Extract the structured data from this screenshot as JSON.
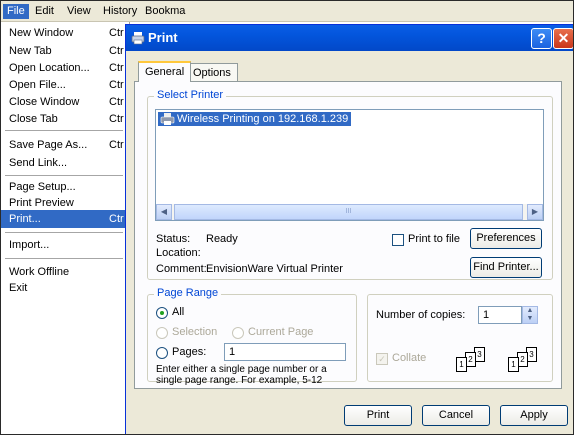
{
  "menubar": {
    "items": [
      "File",
      "Edit",
      "View",
      "History",
      "Bookma"
    ]
  },
  "file_menu": {
    "items": [
      {
        "label": "New Window",
        "shortcut": "Ctr"
      },
      {
        "label": "New Tab",
        "shortcut": "Ctr"
      },
      {
        "label": "Open Location...",
        "shortcut": "Ctr"
      },
      {
        "label": "Open File...",
        "shortcut": "Ctr"
      },
      {
        "label": "Close Window",
        "shortcut": "Ctr"
      },
      {
        "label": "Close Tab",
        "shortcut": "Ctr"
      },
      {
        "label": "Save Page As...",
        "shortcut": "Ctr"
      },
      {
        "label": "Send Link...",
        "shortcut": ""
      },
      {
        "label": "Page Setup...",
        "shortcut": ""
      },
      {
        "label": "Print Preview",
        "shortcut": ""
      },
      {
        "label": "Print...",
        "shortcut": "Ctr"
      },
      {
        "label": "Import...",
        "shortcut": ""
      },
      {
        "label": "Work Offline",
        "shortcut": ""
      },
      {
        "label": "Exit",
        "shortcut": ""
      }
    ]
  },
  "dialog": {
    "title": "Print",
    "help_glyph": "?",
    "close_glyph": "✕",
    "tabs": [
      "General",
      "Options"
    ],
    "select_printer": {
      "title": "Select Printer",
      "printers": [
        "Wireless Printing on 192.168.1.239"
      ],
      "scroll_left": "◀",
      "scroll_right": "▶",
      "scroll_grip": "III"
    },
    "status_label": "Status:",
    "status_value": "Ready",
    "location_label": "Location:",
    "location_value": "",
    "comment_label": "Comment:",
    "comment_value": "EnvisionWare Virtual Printer",
    "print_to_file": "Print to file",
    "preferences": "Preferences",
    "find_printer": "Find Printer...",
    "page_range": {
      "title": "Page Range",
      "all": "All",
      "selection": "Selection",
      "current_page": "Current Page",
      "pages": "Pages:",
      "pages_value": "1",
      "hint": "Enter either a single page number or a single page range.  For example, 5-12"
    },
    "copies": {
      "label": "Number of copies:",
      "value": "1",
      "collate": "Collate",
      "collate_check": "✓",
      "spin_up": "▲",
      "spin_down": "▼",
      "page_numbers": [
        "1",
        "2",
        "3"
      ]
    },
    "buttons": {
      "print": "Print",
      "cancel": "Cancel",
      "apply": "Apply"
    }
  }
}
